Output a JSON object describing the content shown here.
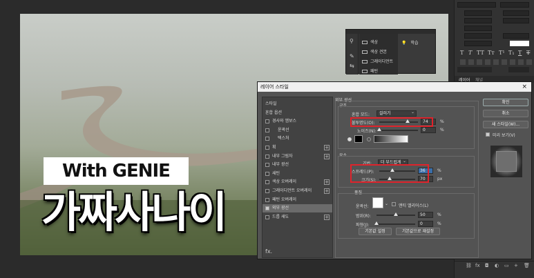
{
  "canvas": {
    "caption_tag": "With GENIE",
    "title": "가짜사나이"
  },
  "right_panel": {
    "tabs": [
      "레이어",
      "채널"
    ]
  },
  "mini_panel": {
    "items": [
      "색상",
      "색상 견본",
      "그레이디언트",
      "패턴"
    ],
    "learn": "학습"
  },
  "dialog": {
    "title": "레이어 스타일",
    "close": "×",
    "styles_list": [
      {
        "label": "스타일",
        "checkbox": false,
        "plus": false,
        "indent": 0
      },
      {
        "label": "혼합 옵션",
        "checkbox": false,
        "plus": false,
        "indent": 0
      },
      {
        "label": "경사와 엠보스",
        "checkbox": true,
        "checked": false,
        "plus": false,
        "indent": 0
      },
      {
        "label": "윤곽선",
        "checkbox": true,
        "checked": false,
        "plus": false,
        "indent": 1
      },
      {
        "label": "텍스처",
        "checkbox": true,
        "checked": false,
        "plus": false,
        "indent": 1
      },
      {
        "label": "획",
        "checkbox": true,
        "checked": false,
        "plus": true,
        "indent": 0
      },
      {
        "label": "내부 그림자",
        "checkbox": true,
        "checked": false,
        "plus": true,
        "indent": 0
      },
      {
        "label": "내부 광선",
        "checkbox": true,
        "checked": false,
        "plus": false,
        "indent": 0
      },
      {
        "label": "새틴",
        "checkbox": true,
        "checked": false,
        "plus": false,
        "indent": 0
      },
      {
        "label": "색상 오버레이",
        "checkbox": true,
        "checked": false,
        "plus": true,
        "indent": 0
      },
      {
        "label": "그레이디언트 오버레이",
        "checkbox": true,
        "checked": false,
        "plus": true,
        "indent": 0
      },
      {
        "label": "패턴 오버레이",
        "checkbox": true,
        "checked": false,
        "plus": false,
        "indent": 0
      },
      {
        "label": "외부 광선",
        "checkbox": true,
        "checked": true,
        "plus": false,
        "indent": 0,
        "selected": true
      },
      {
        "label": "드롭 섀도",
        "checkbox": true,
        "checked": false,
        "plus": true,
        "indent": 0
      }
    ],
    "fx": "fx.",
    "outer_glow": {
      "section_title": "외부 광선",
      "structure_title": "구조",
      "blend_mode_label": "혼합 모드:",
      "blend_mode_value": "걸러기",
      "opacity_label": "불투명도(O):",
      "opacity_value": "74",
      "opacity_unit": "%",
      "opacity_fraction": 0.74,
      "noise_label": "노이즈(N):",
      "noise_value": "0",
      "noise_unit": "%",
      "noise_fraction": 0.0,
      "elements_title": "요소",
      "technique_label": "기법:",
      "technique_value": "더 부드럽게",
      "spread_label": "스프레드(P):",
      "spread_value": "36",
      "spread_unit": "%",
      "spread_fraction": 0.36,
      "size_label": "크기(S):",
      "size_value": "70",
      "size_unit": "px",
      "size_fraction": 0.28,
      "quality_title": "품질",
      "contour_label": "윤곽선:",
      "anti_alias_label": "앤티 앨리어스(L)",
      "range_label": "범위(R):",
      "range_value": "50",
      "range_unit": "%",
      "range_fraction": 0.5,
      "jitter_label": "파형(J):",
      "jitter_value": "0",
      "jitter_unit": "%",
      "jitter_fraction": 0.0,
      "make_default": "기본값 설정",
      "reset_default": "기본값으로 재설정"
    },
    "buttons": {
      "ok": "확인",
      "cancel": "취소",
      "new_style": "새 스타일(W)...",
      "preview": "미리 보기(V)"
    },
    "colors": {
      "highlight_red": "#e0232b",
      "glow_color": "#000000"
    }
  }
}
